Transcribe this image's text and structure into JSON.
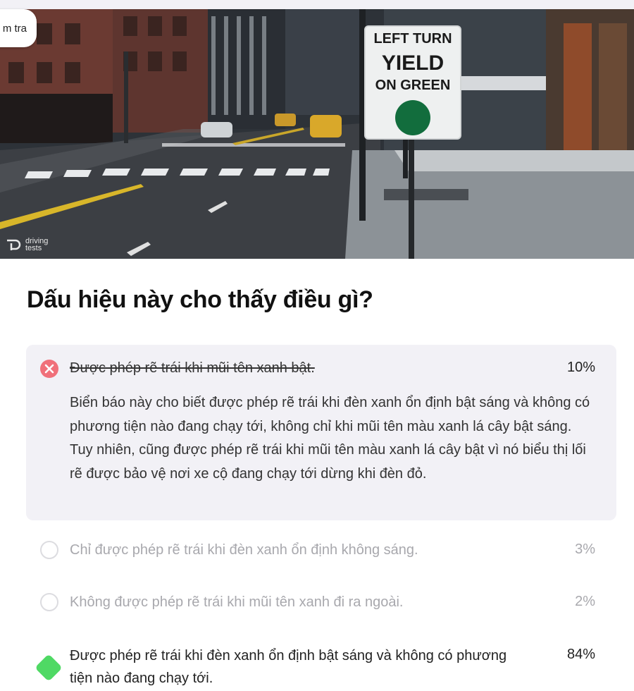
{
  "header": {
    "pill_label": "m tra",
    "watermark": "driving tests"
  },
  "sign": {
    "line1": "LEFT TURN",
    "line2": "YIELD",
    "line3": "ON GREEN",
    "circle_color": "#126d3d"
  },
  "question": {
    "title": "Dấu hiệu này cho thấy điều gì?"
  },
  "answers": [
    {
      "text": "Được phép rẽ trái khi mũi tên xanh bật.",
      "percent": "10%",
      "state": "wrong-selected",
      "explanation": "Biển báo này cho biết được phép rẽ trái khi đèn xanh ổn định bật sáng và không có phương tiện nào đang chạy tới, không chỉ khi mũi tên màu xanh lá cây bật sáng. Tuy nhiên, cũng được phép rẽ trái khi mũi tên màu xanh lá cây bật vì nó biểu thị lối rẽ được bảo vệ nơi xe cộ đang chạy tới dừng khi đèn đỏ."
    },
    {
      "text": "Chỉ được phép rẽ trái khi đèn xanh ổn định không sáng.",
      "percent": "3%",
      "state": "unselected"
    },
    {
      "text": "Không được phép rẽ trái khi mũi tên xanh đi ra ngoài.",
      "percent": "2%",
      "state": "unselected"
    },
    {
      "text": "Được phép rẽ trái khi đèn xanh ổn định bật sáng và không có phương tiện nào đang chạy tới.",
      "percent": "84%",
      "state": "correct"
    }
  ],
  "colors": {
    "wrong": "#f0707a",
    "correct": "#4fd964",
    "selected_bg": "#f2f1f6",
    "muted_text": "#a8a8ad"
  }
}
